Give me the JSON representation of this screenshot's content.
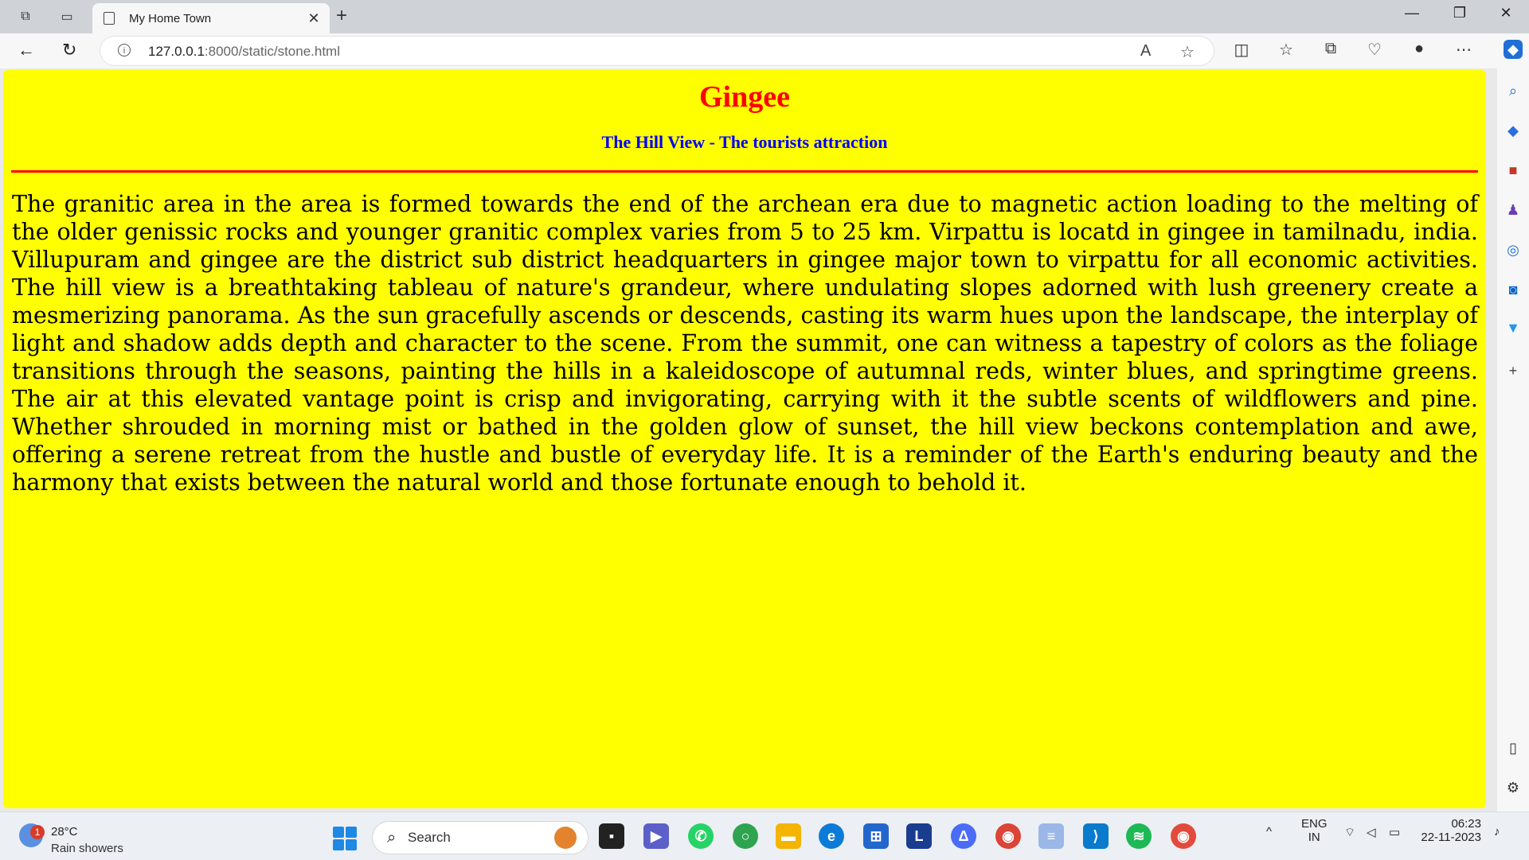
{
  "browser": {
    "tab_title": "My Home Town",
    "url_host": "127.0.0.1",
    "url_path": ":8000/static/stone.html",
    "tab_close": "✕",
    "new_tab": "+"
  },
  "page": {
    "title": "Gingee",
    "subtitle": "The Hill View - The tourists attraction",
    "paragraph": "The granitic area in the area is formed towards the end of the archean era due to magnetic action loading to the melting of the older genissic rocks and younger granitic complex varies from 5 to 25 km. Virpattu is locatd in gingee in tamilnadu, india. Villupuram and gingee are the district sub district headquarters in gingee major town to virpattu for all economic activities. The hill view is a breathtaking tableau of nature's grandeur, where undulating slopes adorned with lush greenery create a mesmerizing panorama. As the sun gracefully ascends or descends, casting its warm hues upon the landscape, the interplay of light and shadow adds depth and character to the scene. From the summit, one can witness a tapestry of colors as the foliage transitions through the seasons, painting the hills in a kaleidoscope of autumnal reds, winter blues, and springtime greens. The air at this elevated vantage point is crisp and invigorating, carrying with it the subtle scents of wildflowers and pine. Whether shrouded in morning mist or bathed in the golden glow of sunset, the hill view beckons contemplation and awe, offering a serene retreat from the hustle and bustle of everyday life. It is a reminder of the Earth's enduring beauty and the harmony that exists between the natural world and those fortunate enough to behold it."
  },
  "taskbar": {
    "weather_temp": "28°C",
    "weather_condition": "Rain showers",
    "weather_badge": "1",
    "search_label": "Search",
    "lang_top": "ENG",
    "lang_bottom": "IN",
    "time": "06:23",
    "date": "22-11-2023"
  },
  "colors": {
    "page_background": "#ffff00",
    "title": "#ff0000",
    "subtitle": "#0000ff",
    "rule": "#ff0000"
  }
}
